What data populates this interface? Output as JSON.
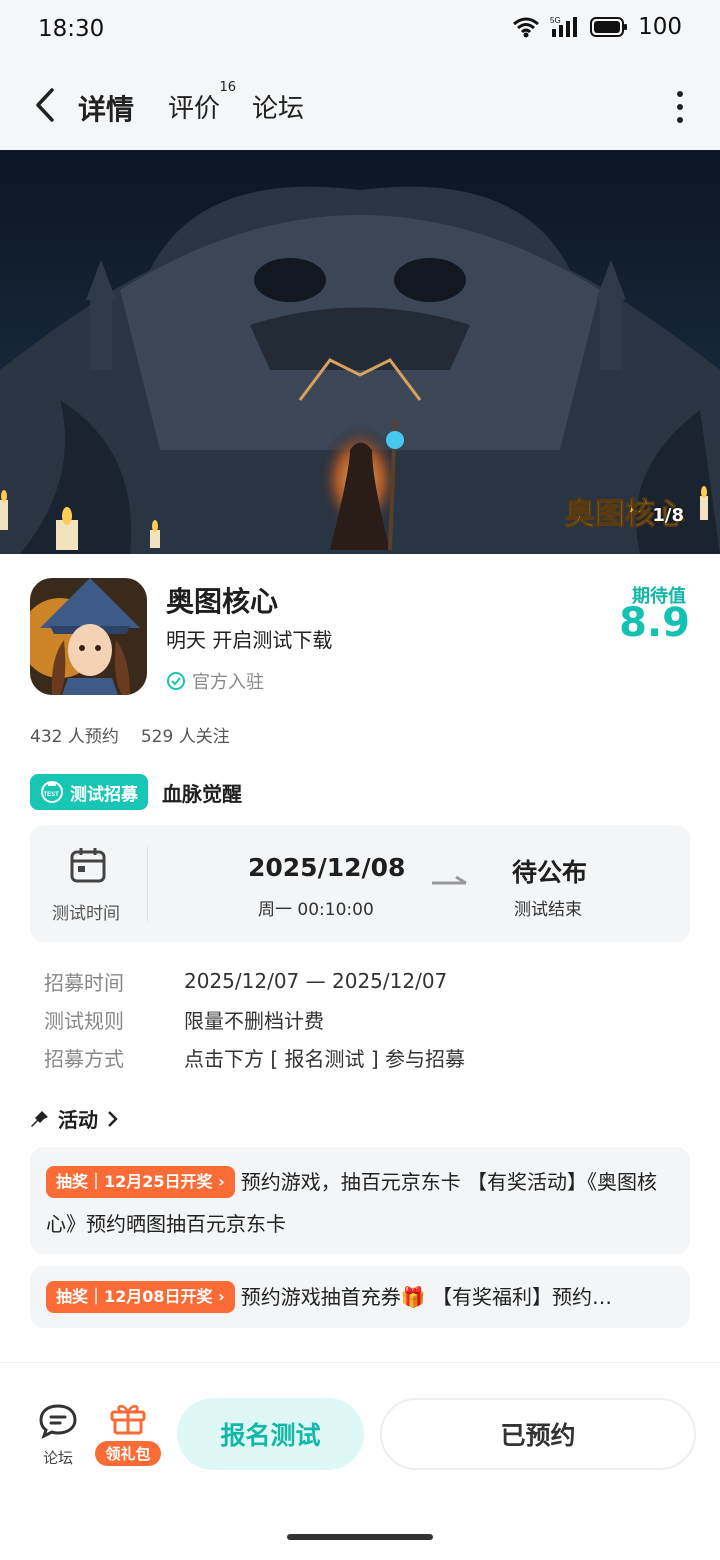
{
  "status_bar": {
    "time": "18:30",
    "battery": "100"
  },
  "nav": {
    "tabs": [
      {
        "label": "详情",
        "active": true
      },
      {
        "label": "评价",
        "badge": "16"
      },
      {
        "label": "论坛"
      }
    ]
  },
  "hero": {
    "logo_text": "奥图核心",
    "counter": "1/8"
  },
  "app": {
    "name": "奥图核心",
    "subtitle": "明天 开启测试下载",
    "official": "官方入驻",
    "expect_label": "期待值",
    "expect_value": "8.9"
  },
  "stats": {
    "reservations": "432 人预约",
    "follows": "529 人关注"
  },
  "test": {
    "tag": "测试招募",
    "tag_icon_text": "TEST",
    "name": "血脉觉醒",
    "time_label": "测试时间",
    "start_date": "2025/12/08",
    "start_time": "周一 00:10:00",
    "end_status": "待公布",
    "end_label": "测试结束"
  },
  "details": [
    {
      "key": "招募时间",
      "value": "2025/12/07 — 2025/12/07"
    },
    {
      "key": "测试规则",
      "value": "限量不删档计费"
    },
    {
      "key": "招募方式",
      "value": "点击下方 [ 报名测试 ] 参与招募"
    }
  ],
  "activities": {
    "title": "活动",
    "items": [
      {
        "tag": "抽奖｜12月25日开奖 ›",
        "text": "预约游戏，抽百元京东卡 【有奖活动】《奥图核心》预约晒图抽百元京东卡"
      },
      {
        "tag": "抽奖｜12月08日开奖 ›",
        "text": "预约游戏抽首充券🎁 【有奖福利】预约…"
      }
    ]
  },
  "bottom": {
    "forum_label": "论坛",
    "gift_label": "领礼包",
    "signup_label": "报名测试",
    "reserved_label": "已预约"
  },
  "colors": {
    "accent": "#13c2b0",
    "orange": "#fb6b35"
  }
}
